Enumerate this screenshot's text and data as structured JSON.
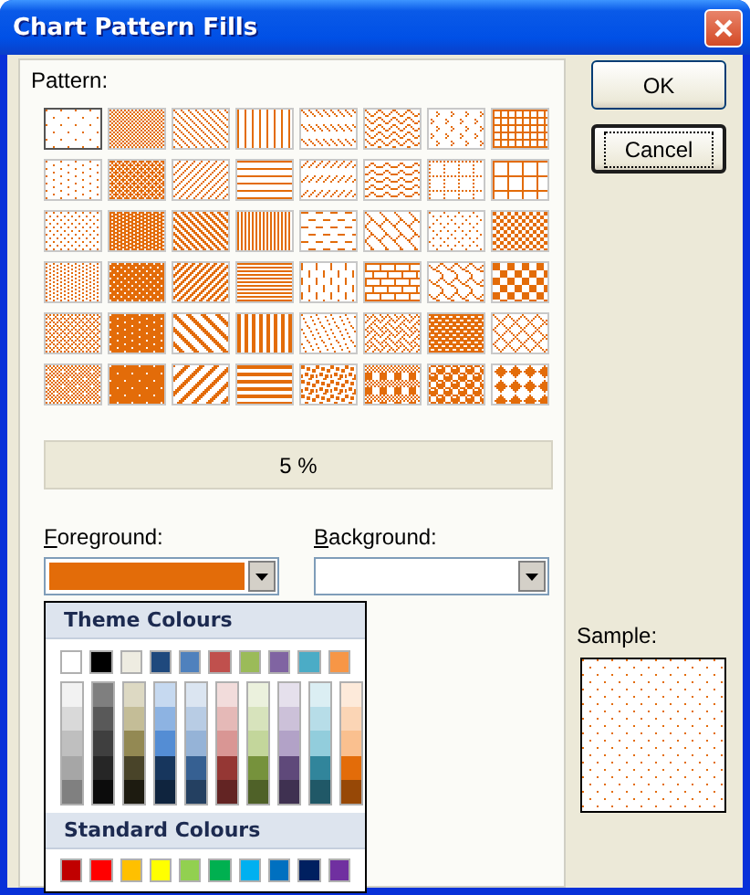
{
  "window": {
    "title": "Chart Pattern Fills"
  },
  "pattern_group": {
    "label": "Pattern:",
    "patterns": [
      {
        "kind": "p05",
        "selected": true
      },
      {
        "kind": "p50",
        "selected": false
      },
      {
        "kind": "ltdn",
        "selected": false
      },
      {
        "kind": "ltvert",
        "selected": false
      },
      {
        "kind": "dashdn",
        "selected": false
      },
      {
        "kind": "zigzag",
        "selected": false
      },
      {
        "kind": "divot",
        "selected": false
      },
      {
        "kind": "smgrid",
        "selected": false
      },
      {
        "kind": "p10",
        "selected": false
      },
      {
        "kind": "p60",
        "selected": false
      },
      {
        "kind": "ltup",
        "selected": false
      },
      {
        "kind": "lthorz",
        "selected": false
      },
      {
        "kind": "dashup",
        "selected": false
      },
      {
        "kind": "wave",
        "selected": false
      },
      {
        "kind": "dotgrid",
        "selected": false
      },
      {
        "kind": "lggrid",
        "selected": false
      },
      {
        "kind": "p20",
        "selected": false
      },
      {
        "kind": "p70",
        "selected": false
      },
      {
        "kind": "dkdn",
        "selected": false
      },
      {
        "kind": "nrwvert",
        "selected": false
      },
      {
        "kind": "dashhorz",
        "selected": false
      },
      {
        "kind": "diagbrick",
        "selected": false
      },
      {
        "kind": "dotdmnd",
        "selected": false
      },
      {
        "kind": "smcheck",
        "selected": false
      },
      {
        "kind": "p25",
        "selected": false
      },
      {
        "kind": "p75",
        "selected": false
      },
      {
        "kind": "dkup",
        "selected": false
      },
      {
        "kind": "nrwhorz",
        "selected": false
      },
      {
        "kind": "dashvert",
        "selected": false
      },
      {
        "kind": "horzbrick",
        "selected": false
      },
      {
        "kind": "shingle",
        "selected": false
      },
      {
        "kind": "lgcheck",
        "selected": false
      },
      {
        "kind": "p30",
        "selected": false
      },
      {
        "kind": "p80",
        "selected": false
      },
      {
        "kind": "wddn",
        "selected": false
      },
      {
        "kind": "dkvert",
        "selected": false
      },
      {
        "kind": "smconfetti",
        "selected": false
      },
      {
        "kind": "weave",
        "selected": false
      },
      {
        "kind": "trellis",
        "selected": false
      },
      {
        "kind": "opendmnd",
        "selected": false
      },
      {
        "kind": "p40",
        "selected": false
      },
      {
        "kind": "p90",
        "selected": false
      },
      {
        "kind": "wdup",
        "selected": false
      },
      {
        "kind": "dkhorz",
        "selected": false
      },
      {
        "kind": "lgconfetti",
        "selected": false
      },
      {
        "kind": "plaid",
        "selected": false
      },
      {
        "kind": "sphere",
        "selected": false
      },
      {
        "kind": "soliddmnd",
        "selected": false
      }
    ],
    "pattern_name": "5 %"
  },
  "foreground": {
    "label": "Foreground:",
    "color": "#e36c09"
  },
  "background": {
    "label": "Background:",
    "color": "#ffffff"
  },
  "color_menu": {
    "theme_title": "Theme Colours",
    "theme_rows": [
      {
        "swatches": [
          {
            "color": "#ffffff"
          },
          {
            "color": "#000000"
          },
          {
            "color": "#eeece1"
          },
          {
            "color": "#1f497d"
          },
          {
            "color": "#4f81bd"
          },
          {
            "color": "#c0504d"
          },
          {
            "color": "#9bbb59"
          },
          {
            "color": "#8064a2"
          },
          {
            "color": "#4bacc6"
          },
          {
            "color": "#f79646"
          }
        ]
      },
      {
        "swatches": [
          {
            "color": "#f2f2f2"
          },
          {
            "color": "#7f7f7f"
          },
          {
            "color": "#ddd9c3"
          },
          {
            "color": "#c6d9f0"
          },
          {
            "color": "#dbe5f1"
          },
          {
            "color": "#f2dcdb"
          },
          {
            "color": "#ebf1dd"
          },
          {
            "color": "#e5e0ec"
          },
          {
            "color": "#dbeef3"
          },
          {
            "color": "#fdeada"
          }
        ]
      },
      {
        "swatches": [
          {
            "color": "#d9d9d9"
          },
          {
            "color": "#595959"
          },
          {
            "color": "#c4bd97"
          },
          {
            "color": "#8db3e2"
          },
          {
            "color": "#b8cce4"
          },
          {
            "color": "#e5b9b7"
          },
          {
            "color": "#d7e3bc"
          },
          {
            "color": "#ccc1d9"
          },
          {
            "color": "#b7dde8"
          },
          {
            "color": "#fbd5b5"
          }
        ]
      },
      {
        "swatches": [
          {
            "color": "#bfbfbf"
          },
          {
            "color": "#3f3f3f"
          },
          {
            "color": "#938953"
          },
          {
            "color": "#548dd4"
          },
          {
            "color": "#95b3d7"
          },
          {
            "color": "#d99694"
          },
          {
            "color": "#c3d69b"
          },
          {
            "color": "#b2a2c7"
          },
          {
            "color": "#92cddc"
          },
          {
            "color": "#fac08f"
          }
        ]
      },
      {
        "swatches": [
          {
            "color": "#a6a6a6"
          },
          {
            "color": "#262626"
          },
          {
            "color": "#494429"
          },
          {
            "color": "#17365d"
          },
          {
            "color": "#366092"
          },
          {
            "color": "#953734"
          },
          {
            "color": "#76923c"
          },
          {
            "color": "#5f497a"
          },
          {
            "color": "#31859b"
          },
          {
            "color": "#e36c09"
          }
        ]
      },
      {
        "swatches": [
          {
            "color": "#808080"
          },
          {
            "color": "#0c0c0c"
          },
          {
            "color": "#1d1b10"
          },
          {
            "color": "#0f243e"
          },
          {
            "color": "#244061"
          },
          {
            "color": "#632423"
          },
          {
            "color": "#4f6128"
          },
          {
            "color": "#3f3151"
          },
          {
            "color": "#205867"
          },
          {
            "color": "#974806"
          }
        ]
      }
    ],
    "standard_title": "Standard Colours",
    "standard": [
      {
        "color": "#c00000"
      },
      {
        "color": "#ff0000"
      },
      {
        "color": "#ffc000"
      },
      {
        "color": "#ffff00"
      },
      {
        "color": "#92d050"
      },
      {
        "color": "#00b050"
      },
      {
        "color": "#00b0f0"
      },
      {
        "color": "#0070c0"
      },
      {
        "color": "#002060"
      },
      {
        "color": "#7030a0"
      }
    ]
  },
  "buttons": [
    {
      "label": "OK",
      "focused": false
    },
    {
      "label": "Cancel",
      "focused": true
    }
  ],
  "sample": {
    "label": "Sample:"
  }
}
